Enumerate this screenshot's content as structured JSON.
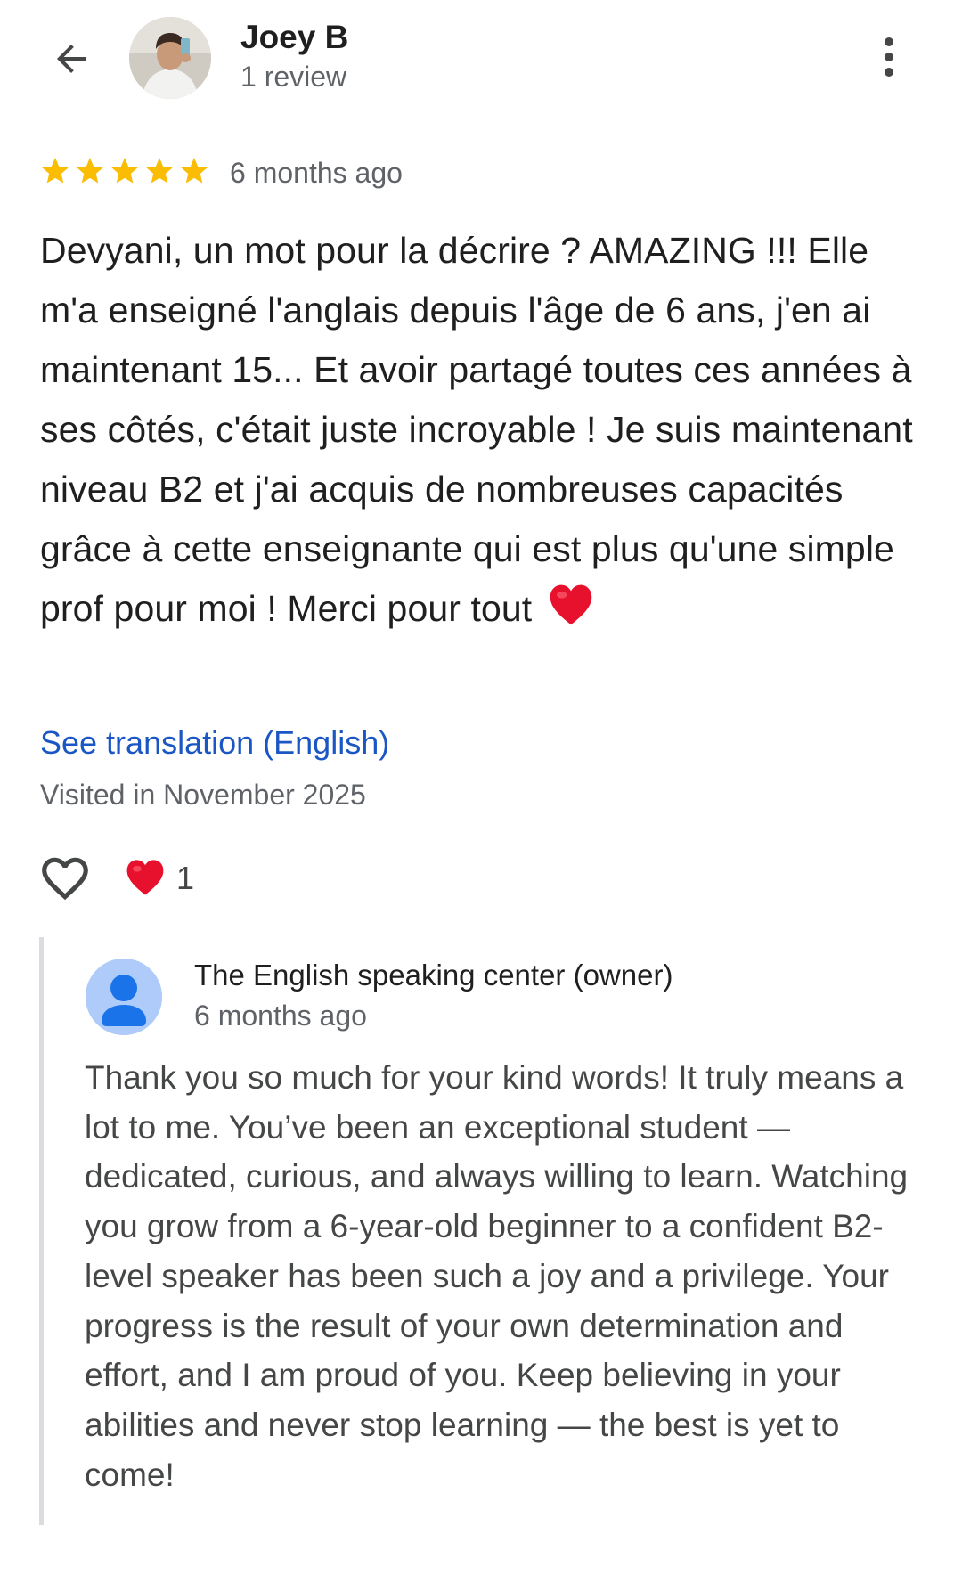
{
  "header": {
    "back_icon": "arrow-back-icon",
    "author_name": "Joey B",
    "author_reviews": "1 review",
    "more_icon": "more-vert-icon"
  },
  "review": {
    "rating": 5,
    "rating_max": 5,
    "star_color": "#fbbc04",
    "age": "6 months ago",
    "text": "Devyani, un mot pour la décrire ? AMAZING !!! Elle m'a enseigné l'anglais depuis l'âge de 6 ans, j'en ai maintenant 15... Et avoir partagé toutes ces années à ses côtés, c'était juste incroyable ! Je suis maintenant niveau B2 et j'ai acquis de nombreuses capacités grâce à cette enseignante qui est plus qu'une simple prof pour moi ! Merci pour tout",
    "text_emoji": "red-heart-emoji",
    "translation_link": "See translation (English)",
    "visited": "Visited in November 2025"
  },
  "reactions": {
    "like_icon": "heart-outline-icon",
    "reaction_icon": "red-heart-emoji",
    "count": "1"
  },
  "owner_response": {
    "avatar_icon": "person-avatar-icon",
    "name": "The English speaking center (owner)",
    "age": "6 months ago",
    "text": "Thank you so much for your kind words! It truly means a lot to me. You’ve been an exceptional student — dedicated, curious, and always willing to learn. Watching you grow from a 6-year-old beginner to a confident B2-level speaker has been such a joy and a privilege. Your progress is the result of your own determination and effort, and I am proud of you. Keep believing in your abilities and never stop learning — the best is yet to come!"
  },
  "colors": {
    "link": "#1a56c4",
    "star": "#fbbc04",
    "heart": "#e8112d",
    "owner_avatar_bg": "#aecbfa",
    "owner_avatar_fg": "#1a73e8"
  }
}
